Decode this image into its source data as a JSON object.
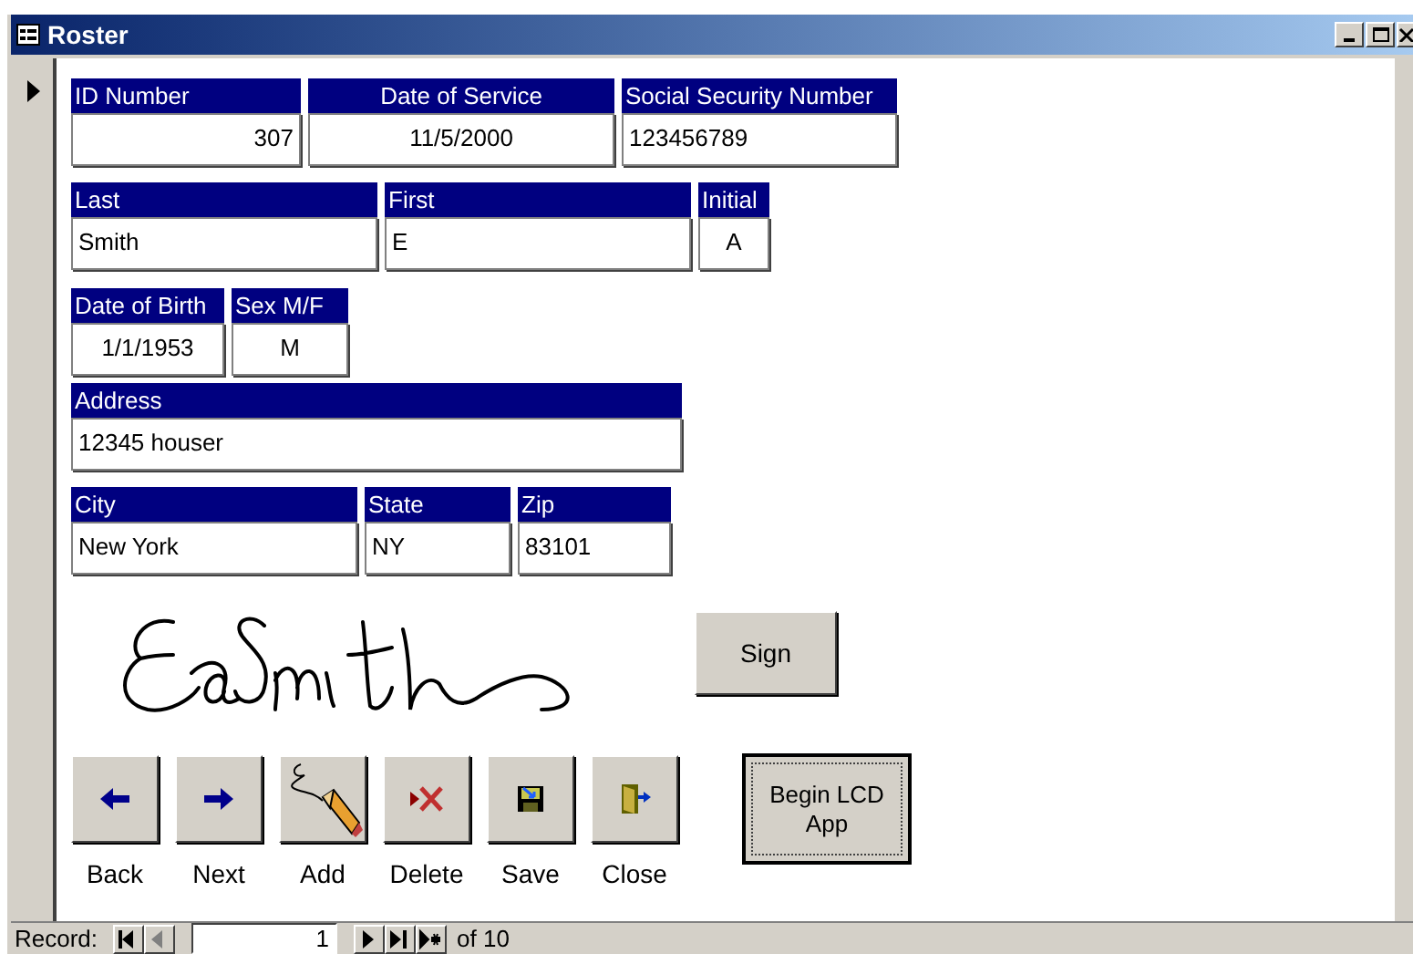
{
  "window": {
    "title": "Roster"
  },
  "field_rows": [
    [
      {
        "label": "ID Number",
        "value": "307"
      },
      {
        "label": "Date of Service",
        "value": "11/5/2000"
      },
      {
        "label": "Social Security Number",
        "value": "123456789"
      }
    ],
    [
      {
        "label": "Last",
        "value": "Smith"
      },
      {
        "label": "First",
        "value": "E"
      },
      {
        "label": "Initial",
        "value": "A"
      }
    ],
    [
      {
        "label": "Date of Birth",
        "value": "1/1/1953"
      },
      {
        "label": "Sex M/F",
        "value": "M"
      }
    ],
    [
      {
        "label": "Address",
        "value": "12345 houser"
      }
    ],
    [
      {
        "label": "City",
        "value": "New York"
      },
      {
        "label": "State",
        "value": "NY"
      },
      {
        "label": "Zip",
        "value": "83101"
      }
    ]
  ],
  "sign_button": "Sign",
  "actions": [
    {
      "kind": "back",
      "label": "Back"
    },
    {
      "kind": "next",
      "label": "Next"
    },
    {
      "kind": "add",
      "label": "Add"
    },
    {
      "kind": "delete",
      "label": "Delete"
    },
    {
      "kind": "save",
      "label": "Save"
    },
    {
      "kind": "close",
      "label": "Close"
    }
  ],
  "lcd_button": "Begin LCD App",
  "record_nav": {
    "label": "Record:",
    "current": "1",
    "total": "of 10",
    "buttons": [
      {
        "kind": "first",
        "disabled": false
      },
      {
        "kind": "prev",
        "disabled": true
      },
      {
        "kind": "next",
        "disabled": false
      },
      {
        "kind": "last",
        "disabled": false
      },
      {
        "kind": "new",
        "disabled": false
      }
    ]
  }
}
